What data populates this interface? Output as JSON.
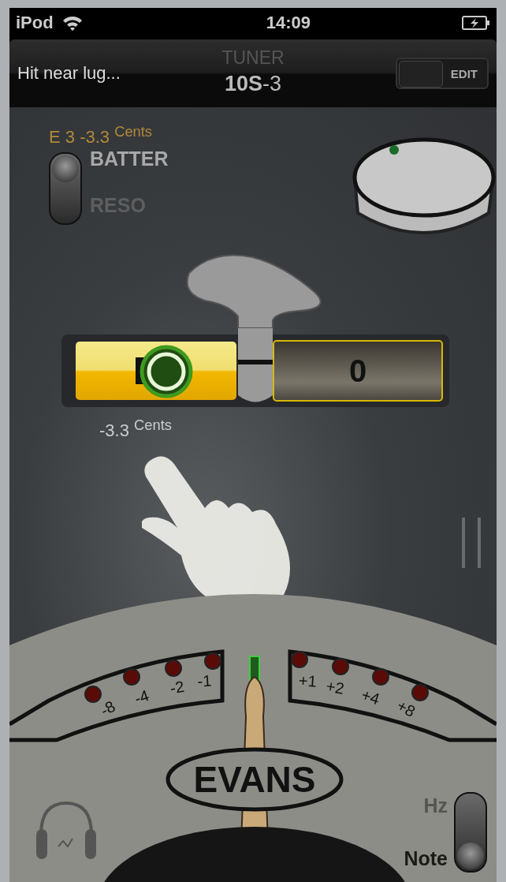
{
  "status_bar": {
    "carrier": "iPod",
    "time": "14:09"
  },
  "nav_bar": {
    "hint": "Hit near lug...",
    "title": "TUNER",
    "drum": "**10S**-3",
    "edit_toggle": {
      "label": "EDIT",
      "on": false
    }
  },
  "reading": "E 3 -3.3 $^{Cents}$",
  "head_switch": [
    {
      "label": "BATTER",
      "selected": true
    },
    {
      "label": "RESO",
      "selected": false
    }
  ],
  "left_display": {
    "caption": "-3.3 $^{Cents}$"
  },
  "right_display": {
    "value": "0"
  },
  "meter": {
    "center_lit": true,
    "marks": [
      {
        "label": "-8",
        "lit": false
      },
      {
        "label": "-4",
        "lit": false
      },
      {
        "label": "-2",
        "lit": false
      },
      {
        "label": "-1",
        "lit": false
      },
      {
        "label": "+1",
        "lit": false
      },
      {
        "label": "+2",
        "lit": false
      },
      {
        "label": "+4",
        "lit": false
      },
      {
        "label": "+8",
        "lit": false
      }
    ]
  },
  "logo": "EVANS",
  "mode_switch": [
    {
      "label": "Hz",
      "selected": false
    },
    {
      "label": "Note",
      "selected": true
    }
  ]
}
